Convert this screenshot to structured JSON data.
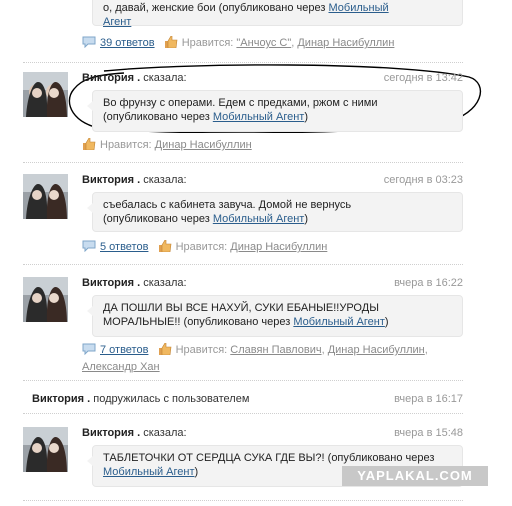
{
  "top_fragment": {
    "text_prefix": "о, давай, женские бои",
    "text_suffix": "(опубликовано через",
    "via_link": "Мобильный",
    "via_link_2": "Агент",
    "comments_link": "39 ответов",
    "likes_label": "Нравится:",
    "likers": [
      "\"Анчоус С\"",
      "Динар Насибуллин"
    ]
  },
  "posts": [
    {
      "author": "Виктория .",
      "action": "сказала:",
      "time": "сегодня в 13:42",
      "text": "Во фрунзу с операми. Едем с предками, ржом с ними",
      "via_prefix": "(опубликовано через ",
      "via_link": "Мобильный Агент",
      "via_suffix": ")",
      "comments_link": "",
      "likes_label": "Нравится:",
      "likers": [
        "Динар Насибуллин"
      ]
    },
    {
      "author": "Виктория .",
      "action": "сказала:",
      "time": "сегодня в 03:23",
      "text": "съебалась с кабинета завуча. Домой не вернусь",
      "via_prefix": "(опубликовано через ",
      "via_link": "Мобильный Агент",
      "via_suffix": ")",
      "comments_link": "5 ответов",
      "likes_label": "Нравится:",
      "likers": [
        "Динар Насибуллин"
      ]
    },
    {
      "author": "Виктория .",
      "action": "сказала:",
      "time": "вчера в 16:22",
      "text": "ДА ПОШЛИ ВЫ ВСЕ НАХУЙ, СУКИ ЕБАНЫЕ!!УРОДЫ МОРАЛЬНЫЕ!!",
      "via_prefix": "(опубликовано через ",
      "via_link": "Мобильный Агент",
      "via_suffix": ")",
      "comments_link": "7 ответов",
      "likes_label": "Нравится:",
      "likers": [
        "Славян Павлович",
        "Динар Насибуллин",
        "Александр Хан"
      ]
    },
    {
      "author": "Виктория .",
      "action": "сказала:",
      "time": "вчера в 15:48",
      "text": "ТАБЛЕТОЧКИ ОТ СЕРДЦА СУКА ГДЕ ВЫ?!",
      "via_prefix": "(опубликовано через ",
      "via_link": "Мобильный Агент",
      "via_suffix": ")"
    }
  ],
  "friend_event": {
    "author": "Виктория .",
    "action": "подружилась с пользователем",
    "time": "вчера в 16:17"
  },
  "watermark": "YAPLAKAL.COM",
  "colors": {
    "link": "#2a5d8c",
    "muted": "#999999",
    "bubble": "#f3f3f3"
  }
}
